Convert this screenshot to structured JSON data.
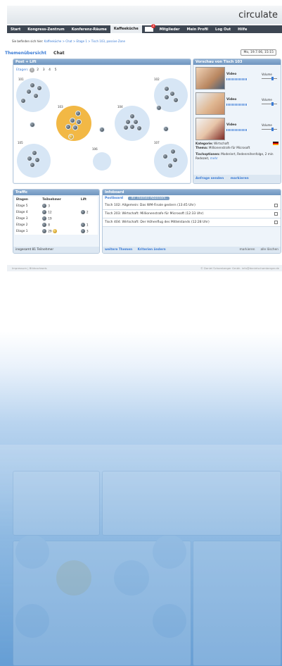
{
  "brand": {
    "logo": "circulate"
  },
  "nav": {
    "items": [
      "Start",
      "Kongress-Zentrum",
      "Konferenz-Räume",
      "Kaffeeküche"
    ],
    "active": "Kaffeeküche",
    "mail_count": "3",
    "right_items": [
      "Mitglieder",
      "Mein Profil",
      "Log Out",
      "Hilfe"
    ]
  },
  "breadcrumb": {
    "prefix": "Sie befinden sich hier:",
    "path": "Kaffeeküche > Chat > Etage 1 > Tisch 103, passive Zone"
  },
  "tabs": {
    "overview": "Themenübersicht",
    "chat": "Chat"
  },
  "date": "Mo, 19.7.06, 15:15",
  "floor": {
    "title": "Post + Lift",
    "etagen_label": "Etagen:",
    "etagen": [
      "1",
      "2",
      "3",
      "4",
      "5"
    ],
    "tables": [
      "101",
      "102",
      "103",
      "104",
      "105",
      "106",
      "107"
    ]
  },
  "preview": {
    "title": "Vorschau von Tisch 103",
    "video_label": "Video",
    "volume_label": "Volume",
    "kategorie_label": "Kategorie:",
    "kategorie": "Wirtschaft",
    "thema_label": "Thema:",
    "thema": "Millionenstrafe für Microsoft",
    "optionen_label": "Tischoptionen:",
    "optionen": "Moderiert, Redenreihenfolge, 2 min Redezeit,",
    "mehr": "mehr",
    "anfrage": "Anfrage senden",
    "markieren": "markieren"
  },
  "traffic": {
    "title": "Traffic",
    "cols": [
      "Etagen",
      "Teilnehmer",
      "Lift"
    ],
    "rows": [
      {
        "etage": "Etage 5",
        "teilnehmer": "3",
        "lift": ""
      },
      {
        "etage": "Etage 4",
        "teilnehmer": "12",
        "lift": "2"
      },
      {
        "etage": "Etage 3",
        "teilnehmer": "19",
        "lift": ""
      },
      {
        "etage": "Etage 2",
        "teilnehmer": "8",
        "lift": "1"
      },
      {
        "etage": "Etage 1",
        "teilnehmer": "29",
        "lift": "3"
      }
    ],
    "footer": "insgesamt 81 Teilnehmer"
  },
  "info": {
    "title": "Infoboard",
    "postboard": "Postboard",
    "themen_btn": "Ihr Themen-Abonnem.",
    "messages": [
      "Tisch 102: Allgemein: Das WM-Finale gestern  (13:45 Uhr)",
      "Tisch 203: Wirtschaft: Millionenstrafe für Microsoft  (12:33 Uhr)",
      "Tisch 404: Wirtschaft: Der Höhenflug des Mittelstands  (12:28 Uhr)"
    ],
    "weitere": "weitere Themen",
    "kriterien": "Kriterien ändern",
    "markieren": "markieren",
    "loeschen": "alle löschen"
  },
  "footer": {
    "left": "Impressum  |  Bildnachweis",
    "right": "© Daniel Schamberger Gmbh. info@danielschamberger.de"
  }
}
